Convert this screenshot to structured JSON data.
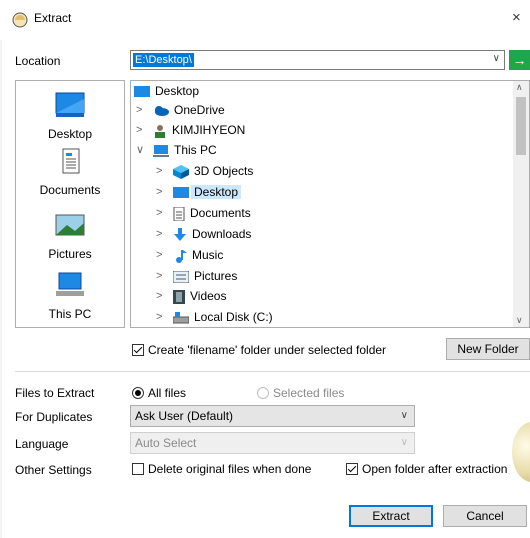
{
  "window": {
    "title": "Extract",
    "close_glyph": "×"
  },
  "location": {
    "label": "Location",
    "value": "E:\\Desktop\\",
    "go_icon": "green-arrow-icon"
  },
  "places": [
    {
      "label": "Desktop",
      "icon": "desktop-icon"
    },
    {
      "label": "Documents",
      "icon": "documents-icon"
    },
    {
      "label": "Pictures",
      "icon": "pictures-icon"
    },
    {
      "label": "This PC",
      "icon": "this-pc-icon"
    }
  ],
  "tree": [
    {
      "label": "Desktop",
      "icon": "desktop-icon",
      "arrow": ""
    },
    {
      "label": "OneDrive",
      "icon": "onedrive-icon",
      "arrow": ">"
    },
    {
      "label": "KIMJIHYEON",
      "icon": "user-icon",
      "arrow": ">"
    },
    {
      "label": "This PC",
      "icon": "this-pc-icon",
      "arrow": "∨"
    },
    {
      "label": "3D Objects",
      "icon": "3d-objects-icon",
      "arrow": ">"
    },
    {
      "label": "Desktop",
      "icon": "desktop-icon",
      "arrow": ">",
      "selected": true
    },
    {
      "label": "Documents",
      "icon": "documents-icon",
      "arrow": ">"
    },
    {
      "label": "Downloads",
      "icon": "downloads-icon",
      "arrow": ">"
    },
    {
      "label": "Music",
      "icon": "music-icon",
      "arrow": ">"
    },
    {
      "label": "Pictures",
      "icon": "pictures-icon",
      "arrow": ">"
    },
    {
      "label": "Videos",
      "icon": "videos-icon",
      "arrow": ">"
    },
    {
      "label": "Local Disk (C:)",
      "icon": "local-disk-icon",
      "arrow": ">"
    }
  ],
  "create_folder": {
    "label": "Create 'filename' folder under selected folder",
    "checked": true
  },
  "new_folder_label": "New Folder",
  "files_to_extract": {
    "label": "Files to Extract",
    "all_files": "All files",
    "selected_files": "Selected files",
    "selected": "All files"
  },
  "duplicates": {
    "label": "For Duplicates",
    "value": "Ask User (Default)"
  },
  "language": {
    "label": "Language",
    "value": "Auto Select"
  },
  "other_settings": {
    "label": "Other Settings",
    "delete_original": {
      "label": "Delete original files when done",
      "checked": false
    },
    "open_folder": {
      "label": "Open folder after extraction",
      "checked": true
    }
  },
  "buttons": {
    "extract": "Extract",
    "cancel": "Cancel"
  },
  "colors": {
    "selection": "#0078d7",
    "tree_selection": "#cce8ff",
    "go_button": "#1fa54a"
  }
}
